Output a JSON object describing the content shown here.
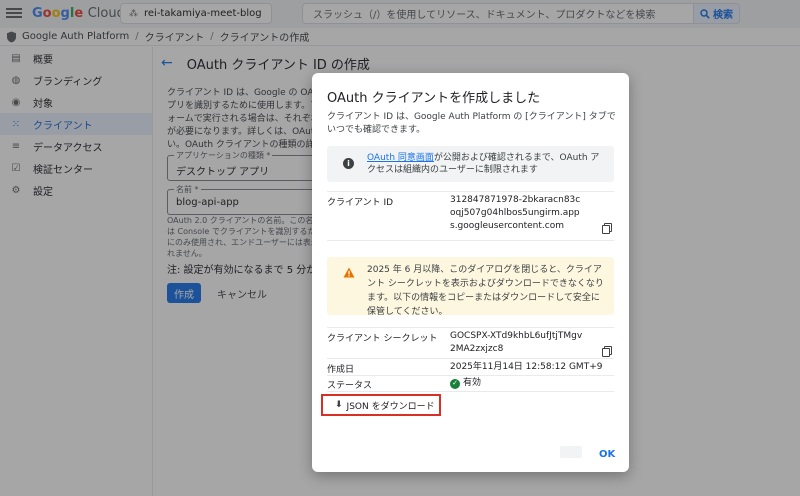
{
  "topbar": {
    "logo_parts": [
      "G",
      "o",
      "o",
      "g",
      "l",
      "e"
    ],
    "logo_suffix": "Cloud",
    "project": "rei-takamiya-meet-blog",
    "search_placeholder": "スラッシュ（/）を使用してリソース、ドキュメント、プロダクトなどを検索",
    "search_button": "検索"
  },
  "breadcrumb": [
    "Google Auth Platform",
    "クライアント",
    "クライアントの作成"
  ],
  "sidebar": {
    "items": [
      {
        "label": "概要",
        "icon": "grid-icon"
      },
      {
        "label": "ブランディング",
        "icon": "palette-icon"
      },
      {
        "label": "対象",
        "icon": "person-icon"
      },
      {
        "label": "クライアント",
        "icon": "apps-icon",
        "active": true
      },
      {
        "label": "データアクセス",
        "icon": "tune-icon"
      },
      {
        "label": "検証センター",
        "icon": "checkbox-icon"
      },
      {
        "label": "設定",
        "icon": "gear-icon"
      }
    ]
  },
  "main": {
    "title": "OAuth クライアント ID の作成",
    "description": "クライアント ID は、Google の OAuth サーバーから単一のアプリを識別するために使用します。アプリが複数のプラットフォームで実行される場合は、それぞれに独自のクライアント ID が必要になります。詳しくは、OAuth 2.0 の設定をご覧ください。OAuth クライアントの種類の詳細",
    "app_type_label": "アプリケーションの種類 *",
    "app_type_value": "デスクトップ アプリ",
    "name_label": "名前 *",
    "name_value": "blog-api-app",
    "name_help": "OAuth 2.0 クライアントの名前。この名前は Console でクライアントを識別するためにのみ使用され、エンドユーザーには表示されません。",
    "note": "注: 設定が有効になるまで 5 分から数",
    "create_button": "作成",
    "cancel_button": "キャンセル"
  },
  "dialog": {
    "title": "OAuth クライアントを作成しました",
    "subtitle": "クライアント ID は、Google Auth Platform の [クライアント] タブでいつでも確認できます。",
    "info_link": "OAuth 同意画面",
    "info_text": "が公開および確認されるまで、OAuth アクセスは組織内のユーザーに制限されます",
    "client_id_label": "クライアント ID",
    "client_id_value": "312847871978-2bkaracn83coqj507g04hlbos5ungirm.apps.googleusercontent.com",
    "warning": "2025 年 6 月以降、このダイアログを閉じると、クライアント シークレットを表示およびダウンロードできなくなります。以下の情報をコピーまたはダウンロードして安全に保管してください。",
    "secret_label": "クライアント シークレット",
    "secret_value": "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",
    "created_label": "作成日",
    "created_value": "2025年11月14日 12:58:12 GMT+9",
    "status_label": "ステータス",
    "status_value": "有効",
    "json_button": "JSON をダウンロード",
    "ok_button": "OK",
    "accent": "#1a73e8",
    "highlight": "#d93025"
  }
}
